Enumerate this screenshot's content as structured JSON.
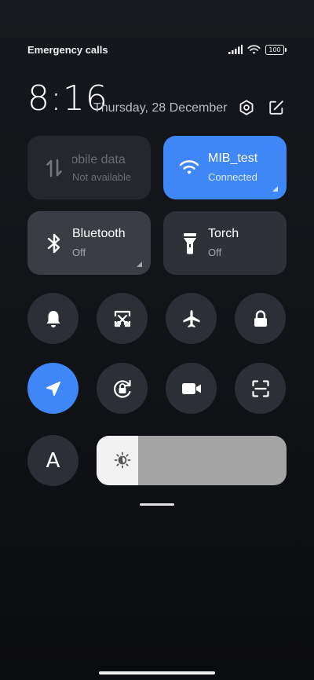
{
  "status": {
    "carrier": "Emergency calls only",
    "battery": "100"
  },
  "header": {
    "time": "8:16",
    "date": "Thursday, 28 December"
  },
  "tiles": {
    "mobile_data": {
      "label": "Mobile data",
      "state": "Not available"
    },
    "wifi": {
      "label": "MIB_test",
      "state": "Connected"
    },
    "bluetooth": {
      "label": "Bluetooth",
      "state": "Off"
    },
    "torch": {
      "label": "Torch",
      "state": "Off"
    }
  },
  "toggles_row1": [
    "bell-icon",
    "screenshot-icon",
    "airplane-icon",
    "lock-icon"
  ],
  "toggles_row2": [
    "location-icon",
    "rotation-lock-icon",
    "video-icon",
    "scanner-icon"
  ],
  "reading_mode": {
    "label": "A"
  },
  "brightness": {
    "level": 0.22
  },
  "colors": {
    "accent": "#3f86f6",
    "tile_bg": "#2a2d33",
    "background": "#121418"
  }
}
